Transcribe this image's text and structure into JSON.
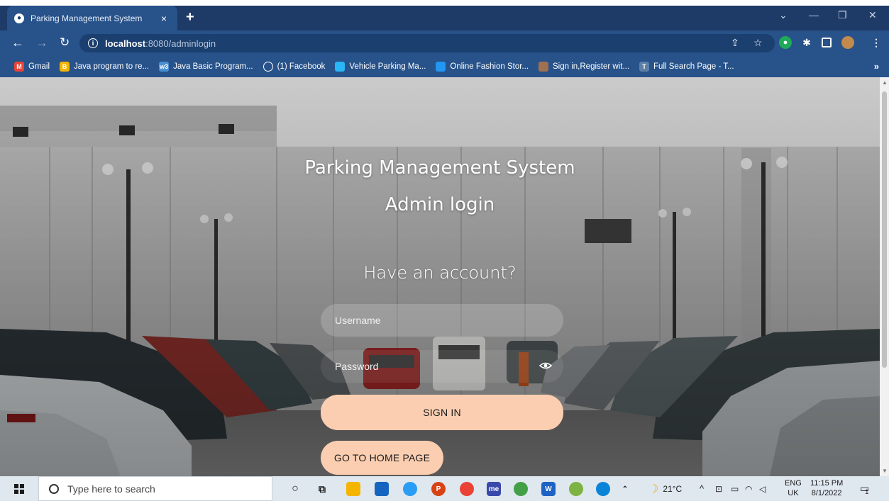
{
  "browser": {
    "tab_title": "Parking Management System",
    "tab_close": "×",
    "new_tab": "+",
    "url_host": "localhost",
    "url_rest": ":8080/adminlogin",
    "bookmarks": [
      {
        "label": "Gmail",
        "icon": "gmail-icon",
        "color": "#ea4335",
        "glyph": "M"
      },
      {
        "label": "Java program to re...",
        "icon": "bookmark-b-icon",
        "color": "#f4b400",
        "glyph": "B"
      },
      {
        "label": "Java Basic Program...",
        "icon": "w3-icon",
        "color": "#4a8fd1",
        "glyph": "w3"
      },
      {
        "label": "(1) Facebook",
        "icon": "globe-icon",
        "color": "#ffffff",
        "glyph": ""
      },
      {
        "label": "Vehicle Parking Ma...",
        "icon": "droplet-icon",
        "color": "#29b6f6",
        "glyph": ""
      },
      {
        "label": "Online Fashion Stor...",
        "icon": "flag-icon",
        "color": "#2196f3",
        "glyph": ""
      },
      {
        "label": "Sign in,Register wit...",
        "icon": "cartoon-icon",
        "color": "#a07050",
        "glyph": ""
      },
      {
        "label": "Full Search Page - T...",
        "icon": "t-icon",
        "color": "#5d7fa6",
        "glyph": "T"
      }
    ],
    "bookmarks_more": "»"
  },
  "page": {
    "title_line1": "Parking Management System",
    "title_line2": "Admin login",
    "have_account": "Have an account?",
    "username_placeholder": "Username",
    "password_placeholder": "Password",
    "sign_in_label": "SIGN IN",
    "home_label": "GO TO HOME PAGE",
    "button_color": "#fbceb1"
  },
  "taskbar": {
    "search_placeholder": "Type here to search",
    "weather": "21°C",
    "lang_top": "ENG",
    "lang_bottom": "UK",
    "time": "11:15 PM",
    "date": "8/1/2022",
    "notification_count": "1"
  }
}
